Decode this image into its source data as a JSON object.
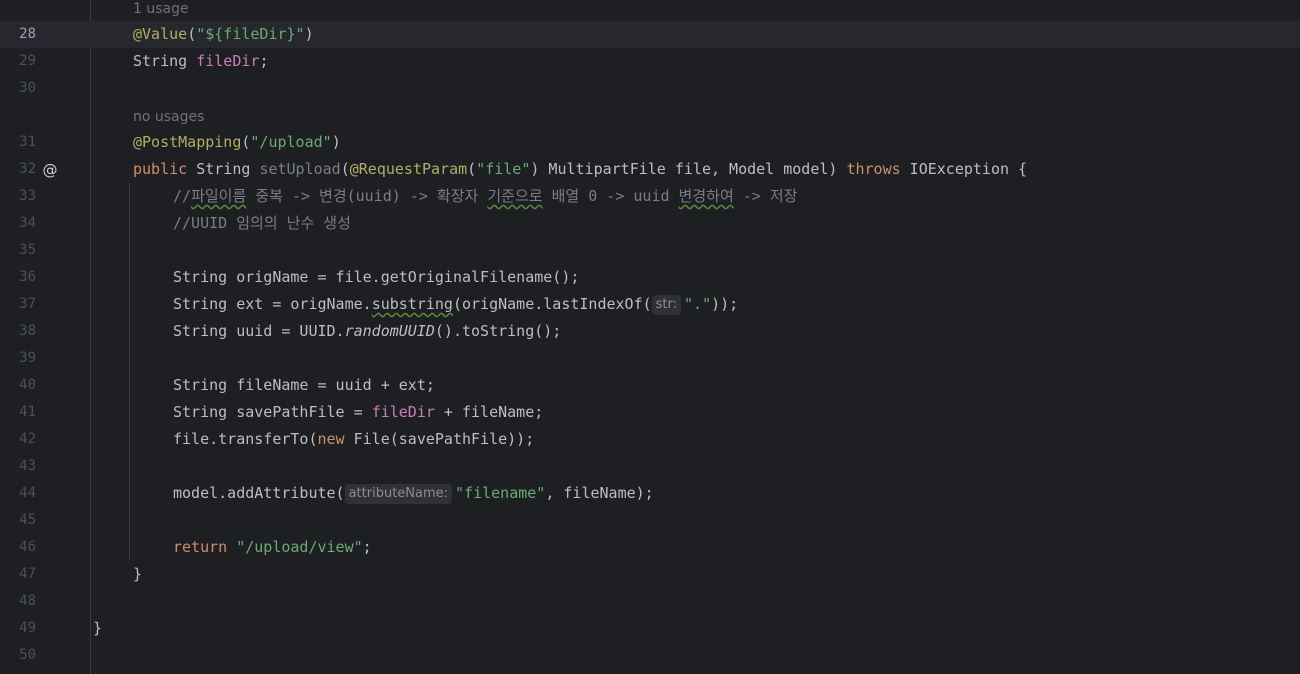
{
  "editor": {
    "colors": {
      "background": "#1e1f22",
      "current_line": "#26282e",
      "keyword": "#cf8e6d",
      "string": "#6aab73",
      "annotation": "#b3ae60",
      "field": "#c77dbb",
      "comment": "#7a7e85"
    },
    "gutter_icon": {
      "name": "implemented-method-icon",
      "glyph": "@"
    },
    "hints": {
      "usage_28": "1 usage",
      "usage_31": "no usages"
    },
    "line_numbers": [
      "28",
      "29",
      "30",
      "31",
      "32",
      "33",
      "34",
      "35",
      "36",
      "37",
      "38",
      "39",
      "40",
      "41",
      "42",
      "43",
      "44",
      "45",
      "46",
      "47",
      "48",
      "49",
      "50"
    ],
    "lines": {
      "l28": {
        "a1": "@Value",
        "p1": "(",
        "s1": "\"${fileDir}\"",
        "p2": ")"
      },
      "l29": {
        "t1": "String ",
        "f1": "fileDir",
        "p1": ";"
      },
      "l31": {
        "a1": "@PostMapping",
        "p1": "(",
        "s1": "\"/upload\"",
        "p2": ")"
      },
      "l32": {
        "k1": "public",
        "t1": " String ",
        "m1": "setUpload",
        "p1": "(",
        "a1": "@RequestParam",
        "p2": "(",
        "s1": "\"file\"",
        "t2": ") MultipartFile file, Model model) ",
        "k2": "throws",
        "t3": " IOException {"
      },
      "l33": {
        "c1": "//",
        "c2": "파일이름",
        "c3": " 중복 -> 변경(uuid) -> 확장자 ",
        "c4": "기준으로",
        "c5": " 배열 0 -> uuid ",
        "c6": "변경하여",
        "c7": " -> 저장"
      },
      "l34": {
        "c1": "//UUID 임의의 난수 생성"
      },
      "l36": {
        "t1": "String origName = file.getOriginalFilename();"
      },
      "l37": {
        "t1": "String ext = origName.",
        "u1": "substring",
        "t2": "(origName.lastIndexOf(",
        "h1": "str:",
        "s1": "\".\"",
        "t3": "));"
      },
      "l38": {
        "t1": "String uuid = UUID.",
        "i1": "randomUUID",
        "t2": "().toString();"
      },
      "l40": {
        "t1": "String fileName = uuid + ext;"
      },
      "l41": {
        "t1": "String savePathFile = ",
        "f1": "fileDir",
        "t2": " + fileName;"
      },
      "l42": {
        "t1": "file.transferTo(",
        "k1": "new",
        "t2": " File(savePathFile));"
      },
      "l44": {
        "t1": "model.addAttribute(",
        "h1": "attributeName:",
        "s1": "\"filename\"",
        "t2": ", fileName);"
      },
      "l46": {
        "k1": "return",
        "t1": " ",
        "s1": "\"/upload/view\"",
        "t2": ";"
      },
      "l47": {
        "t1": "}"
      },
      "l49": {
        "t1": "}"
      }
    }
  }
}
